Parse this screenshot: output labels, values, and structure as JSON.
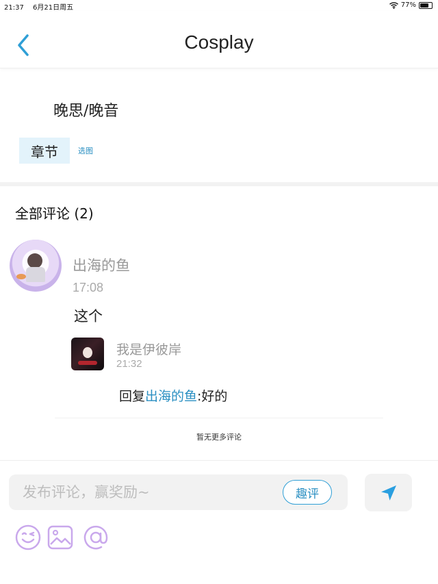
{
  "status_bar": {
    "time": "21:37",
    "date": "6月21日周五",
    "battery_text": "77%",
    "battery_level": 0.77
  },
  "nav": {
    "title": "Cosplay"
  },
  "post": {
    "title": "晚思/晚音",
    "tag_label": "章节",
    "tag_action": "选图"
  },
  "comments": {
    "header": "全部评论 (2)",
    "items": [
      {
        "user": "出海的鱼",
        "time": "17:08",
        "text": "这个",
        "replies": [
          {
            "user": "我是伊彼岸",
            "time": "21:32",
            "prefix": "回复",
            "mention": "出海的鱼",
            "text": ":好的"
          }
        ]
      }
    ],
    "no_more": "暂无更多评论"
  },
  "composer": {
    "placeholder": "发布评论，赢奖励~",
    "fun_button": "趣评",
    "send_icon": "send-icon",
    "tools": [
      "emoji-icon",
      "image-icon",
      "at-icon"
    ]
  },
  "colors": {
    "accent": "#2a8fc2",
    "tag_bg": "#e3f3fb",
    "tool_icon": "#c9a8ec"
  }
}
